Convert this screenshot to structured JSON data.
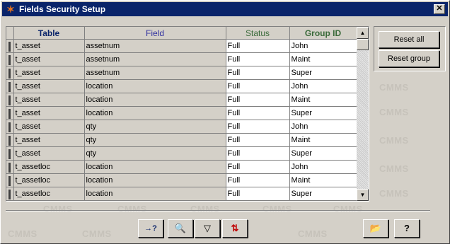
{
  "window": {
    "title": "Fields Security Setup"
  },
  "watermark": "CMMS",
  "grid": {
    "columns": [
      "Table",
      "Field",
      "Status",
      "Group ID"
    ],
    "rows": [
      [
        "t_asset",
        "assetnum",
        "Full",
        "John"
      ],
      [
        "t_asset",
        "assetnum",
        "Full",
        "Maint"
      ],
      [
        "t_asset",
        "assetnum",
        "Full",
        "Super"
      ],
      [
        "t_asset",
        "location",
        "Full",
        "John"
      ],
      [
        "t_asset",
        "location",
        "Full",
        "Maint"
      ],
      [
        "t_asset",
        "location",
        "Full",
        "Super"
      ],
      [
        "t_asset",
        "qty",
        "Full",
        "John"
      ],
      [
        "t_asset",
        "qty",
        "Full",
        "Maint"
      ],
      [
        "t_asset",
        "qty",
        "Full",
        "Super"
      ],
      [
        "t_assetloc",
        "location",
        "Full",
        "John"
      ],
      [
        "t_assetloc",
        "location",
        "Full",
        "Maint"
      ],
      [
        "t_assetloc",
        "location",
        "Full",
        "Super"
      ]
    ]
  },
  "buttons": {
    "reset_all": "Reset all",
    "reset_group": "Reset group"
  },
  "toolbar": {
    "help_arrow": "→?",
    "find": "🔍",
    "filter": "▽",
    "sort": "⇅",
    "open": "📂",
    "help": "?"
  },
  "icons": {
    "window_icon": "app-logo-icon",
    "close": "close-icon"
  }
}
